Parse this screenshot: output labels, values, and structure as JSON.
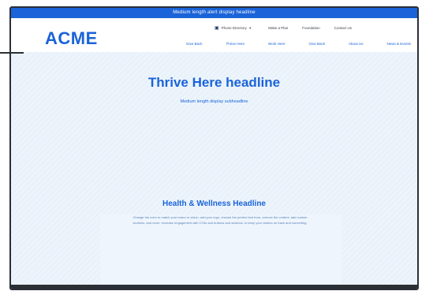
{
  "announcement": "Medium length alert display headline",
  "brand": {
    "logo": "ACME"
  },
  "utility_nav": {
    "directory_icon": "building-icon",
    "directory_label": "Phone Directory",
    "items": [
      "Make a Plan",
      "Foundation",
      "Contact Us"
    ]
  },
  "main_nav": [
    "Give Back",
    "Thrive Here",
    "Work Here",
    "Give Back",
    "About Us",
    "News & Events"
  ],
  "hero": {
    "title": "Thrive Here headline",
    "subtitle": "Medium length display subheadline"
  },
  "section": {
    "title": "Health & Wellness Headline",
    "body": "Change the color to match your brand or vision, add your logo, choose the perfect font from, remove the content, add custom sections, and more. Increase engagement with CTAs and buttons and sections, to keep your visitors on track and converting."
  },
  "colors": {
    "accent": "#1a63d8",
    "hero_bg": "#e9f2fb"
  }
}
